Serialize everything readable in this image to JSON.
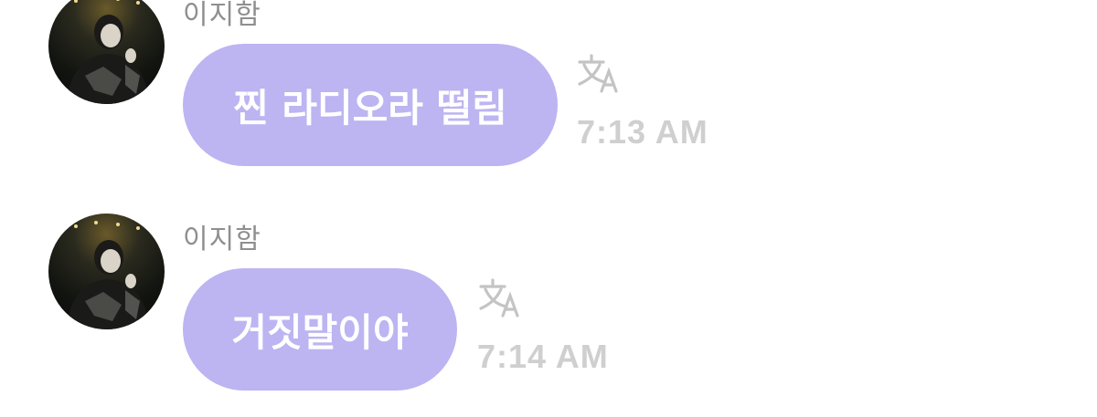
{
  "messages": [
    {
      "sender": "이지함",
      "text": "찐 라디오라 떨림",
      "time": "7:13 AM",
      "translate_icon": "translate-icon"
    },
    {
      "sender": "이지함",
      "text": "거짓말이야",
      "time": "7:14 AM",
      "translate_icon": "translate-icon"
    }
  ],
  "colors": {
    "bubble": "#bdb4f2",
    "bubble_text": "#ffffff",
    "sender_text": "#8f8f8f",
    "time_text": "#cfcfcf",
    "icon": "#c4c4c4"
  }
}
